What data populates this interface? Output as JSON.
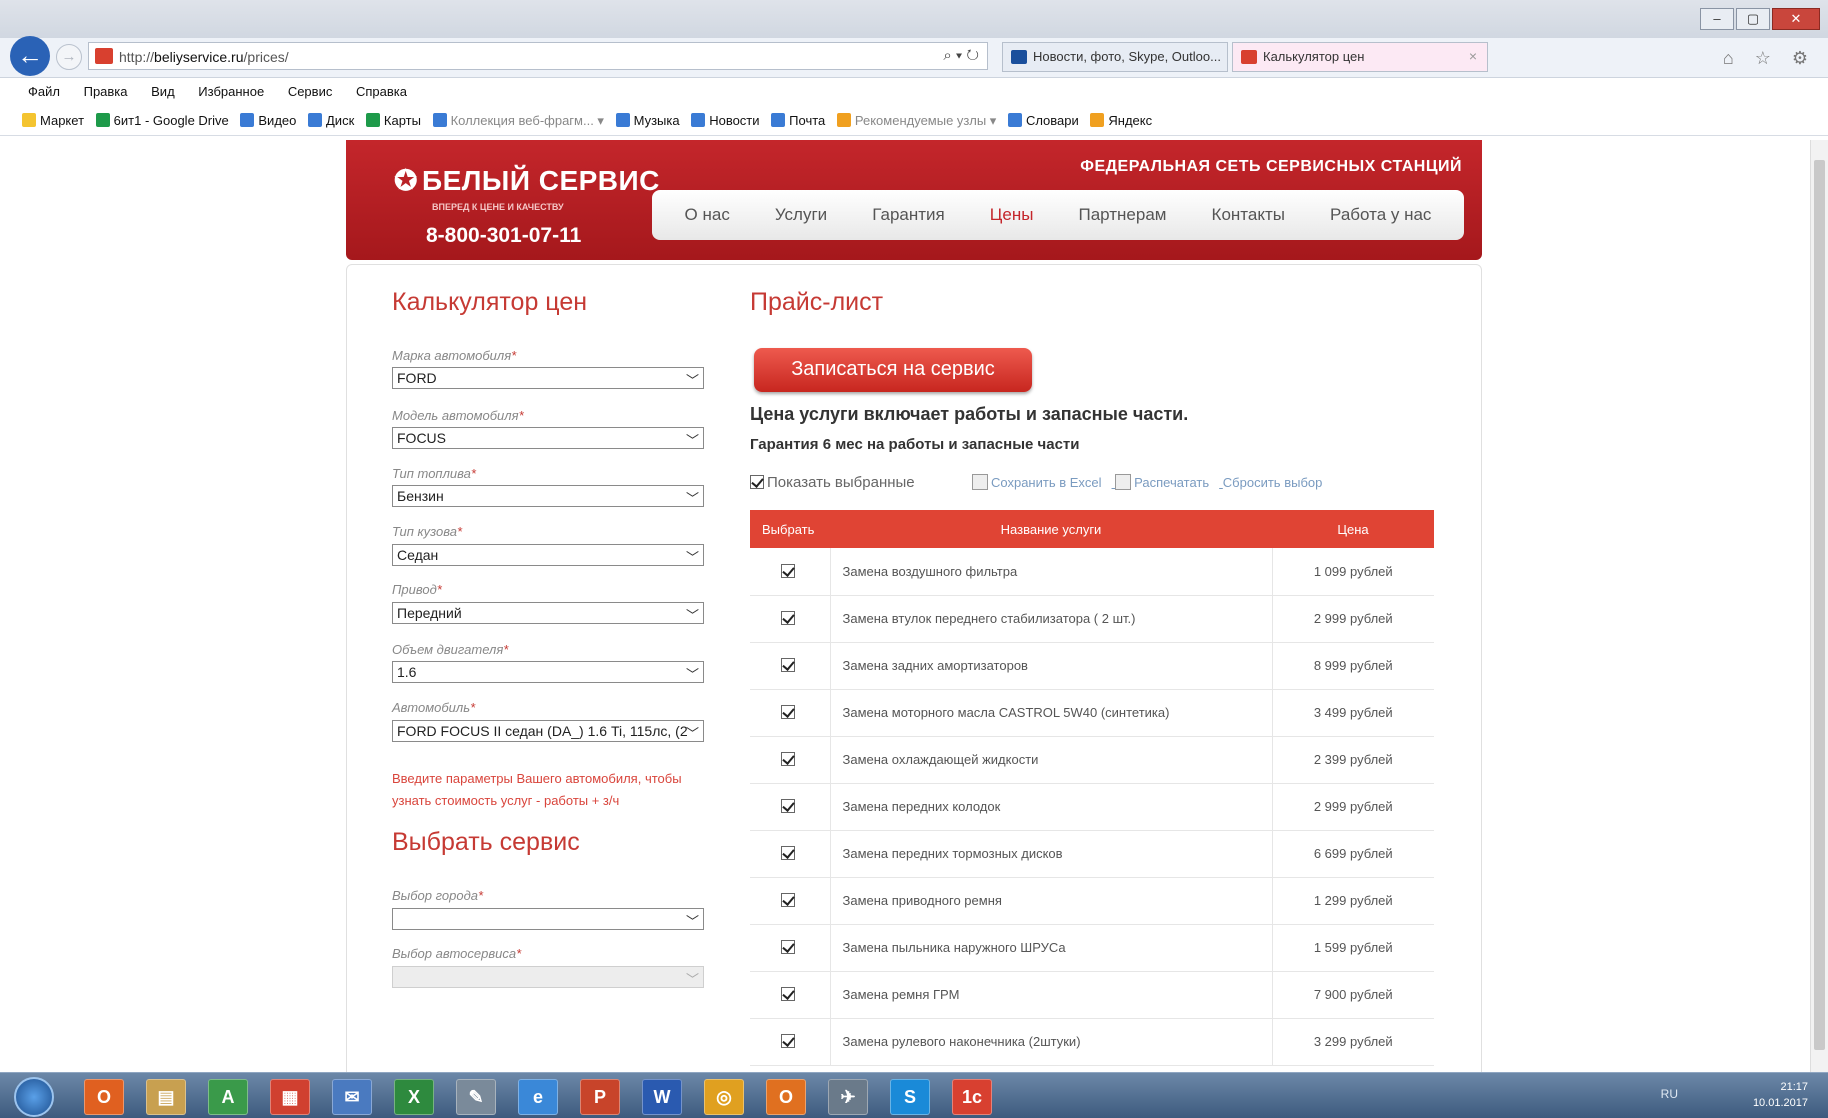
{
  "browser": {
    "url_prefix": "http://",
    "url_host": "beliyservice.ru",
    "url_path": "/prices/",
    "addr_tools": "⌕ ▾ ↻",
    "tabs": [
      {
        "label": "Новости, фото, Skype, Outloo..."
      },
      {
        "label": "Калькулятор цен",
        "close": "×"
      }
    ],
    "window_buttons": [
      "–",
      "▢",
      "✕"
    ],
    "nav_icons": "⌂ ☆ ⚙",
    "menu": [
      "Файл",
      "Правка",
      "Вид",
      "Избранное",
      "Сервис",
      "Справка"
    ],
    "favorites": [
      {
        "label": "Маркет"
      },
      {
        "label": "6ит1 - Google Drive"
      },
      {
        "label": "Видео"
      },
      {
        "label": "Диск"
      },
      {
        "label": "Карты"
      },
      {
        "label": "Коллекция веб-фрагм... ▾"
      },
      {
        "label": "Музыка"
      },
      {
        "label": "Новости"
      },
      {
        "label": "Почта"
      },
      {
        "label": "Рекомендуемые узлы ▾"
      },
      {
        "label": "Словари"
      },
      {
        "label": "Яндекс"
      }
    ]
  },
  "header": {
    "logo": "БЕЛЫЙ СЕРВИС",
    "slogan": "ВПЕРЕД К ЦЕНЕ И КАЧЕСТВУ",
    "phone": "8-800-301-07-11",
    "federal": "ФЕДЕРАЛЬНАЯ СЕТЬ СЕРВИСНЫХ СТАНЦИЙ",
    "nav": [
      "О нас",
      "Услуги",
      "Гарантия",
      "Цены",
      "Партнерам",
      "Контакты",
      "Работа у нас"
    ]
  },
  "calculator": {
    "title": "Калькулятор цен",
    "fields": [
      {
        "label": "Марка автомобиля",
        "value": "FORD"
      },
      {
        "label": "Модель автомобиля",
        "value": "FOCUS"
      },
      {
        "label": "Тип топлива",
        "value": "Бензин"
      },
      {
        "label": "Тип кузова",
        "value": "Седан"
      },
      {
        "label": "Привод",
        "value": "Передний"
      },
      {
        "label": "Объем двигателя",
        "value": "1.6"
      },
      {
        "label": "Автомобиль",
        "value": "FORD FOCUS II седан (DA_) 1.6 Ti, 115лс, (2"
      }
    ],
    "required_mark": "*",
    "hint": "Введите параметры Вашего автомобиля, чтобы узнать стоимость услуг - работы + з/ч"
  },
  "service": {
    "title": "Выбрать сервис",
    "city_label": "Выбор города",
    "city_value": "",
    "autoservice_label": "Выбор автосервиса",
    "autoservice_value": ""
  },
  "pricelist": {
    "title": "Прайс-лист",
    "book_button": "Записаться на сервис",
    "note1": "Цена услуги включает работы и запасные части.",
    "note2": "Гарантия 6 мес на работы и запасные части",
    "show_selected": "Показать выбранные",
    "save_excel": "Сохранить в Excel",
    "print": "Распечатать",
    "reset": "Сбросить выбор",
    "columns": [
      "Выбрать",
      "Название услуги",
      "Цена"
    ],
    "rows": [
      {
        "name": "Замена воздушного фильтра",
        "price": "1 099 рублей"
      },
      {
        "name": "Замена втулок переднего стабилизатора ( 2 шт.)",
        "price": "2 999 рублей"
      },
      {
        "name": "Замена задних амортизаторов",
        "price": "8 999 рублей"
      },
      {
        "name": "Замена моторного масла CASTROL 5W40 (синтетика)",
        "price": "3 499 рублей"
      },
      {
        "name": "Замена охлаждающей жидкости",
        "price": "2 399 рублей"
      },
      {
        "name": "Замена передних колодок",
        "price": "2 999 рублей"
      },
      {
        "name": "Замена передних тормозных дисков",
        "price": "6 699 рублей"
      },
      {
        "name": "Замена приводного ремня",
        "price": "1 299 рублей"
      },
      {
        "name": "Замена пыльника наружного ШРУСа",
        "price": "1 599 рублей"
      },
      {
        "name": "Замена ремня ГРМ",
        "price": "7 900 рублей"
      },
      {
        "name": "Замена рулевого наконечника (2штуки)",
        "price": "3 299 рублей"
      }
    ]
  },
  "taskbar": {
    "apps": [
      "O",
      "▤",
      "A",
      "▦",
      "✉",
      "X",
      "✎",
      "e",
      "P",
      "W",
      "◎",
      "O",
      "✈",
      "S",
      "1c"
    ],
    "lang": "RU",
    "time": "21:17",
    "date": "10.01.2017"
  }
}
